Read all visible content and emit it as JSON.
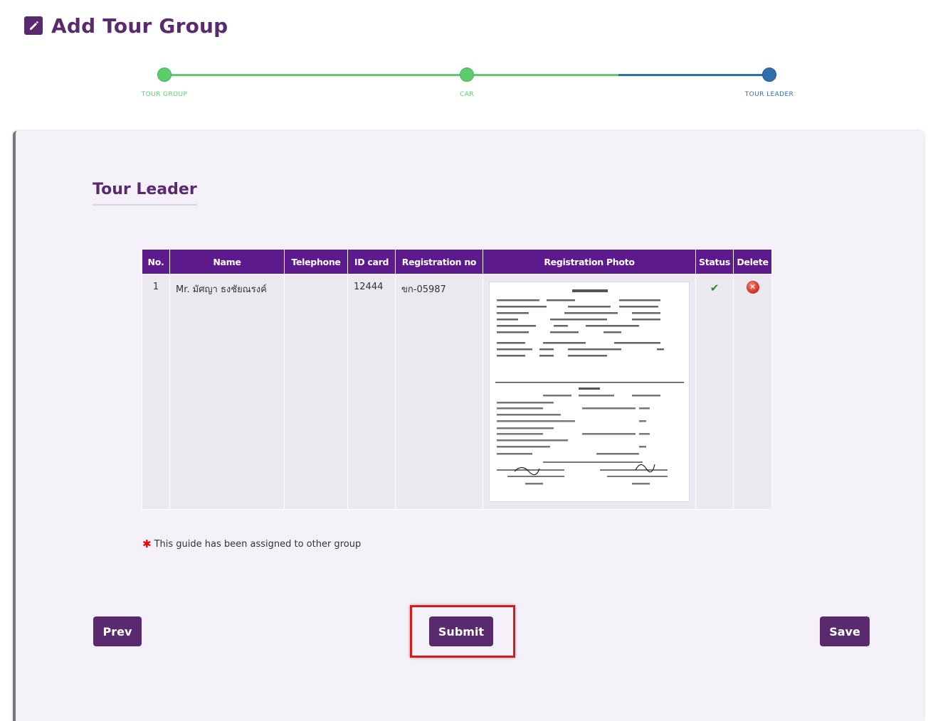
{
  "header": {
    "title": "Add Tour Group",
    "icon": "edit-icon"
  },
  "stepper": {
    "steps": [
      {
        "label": "TOUR GROUP",
        "state": "done"
      },
      {
        "label": "CAR",
        "state": "done"
      },
      {
        "label": "TOUR LEADER",
        "state": "active"
      }
    ],
    "colors": {
      "done": "#5dcc6c",
      "active": "#2f6fae"
    }
  },
  "section": {
    "title": "Tour Leader"
  },
  "table": {
    "headers": [
      "No.",
      "Name",
      "Telephone",
      "ID card",
      "Registration no",
      "Registration Photo",
      "Status",
      "Delete"
    ],
    "rows": [
      {
        "no": "1",
        "name": "Mr. มัศญา ธงชัยณรงค์",
        "telephone": "",
        "id_card": "12444",
        "registration_no": "ขก-05987",
        "photo_icon": "registration-document-image",
        "status_icon": "checkmark-icon",
        "delete_icon": "delete-icon"
      }
    ]
  },
  "note": {
    "text": "This guide has been assigned to other group"
  },
  "buttons": {
    "prev": "Prev",
    "submit": "Submit",
    "save": "Save"
  },
  "colors": {
    "brand": "#5a2a6e",
    "table_header": "#5c1a8c",
    "highlight": "#d41a1a"
  }
}
